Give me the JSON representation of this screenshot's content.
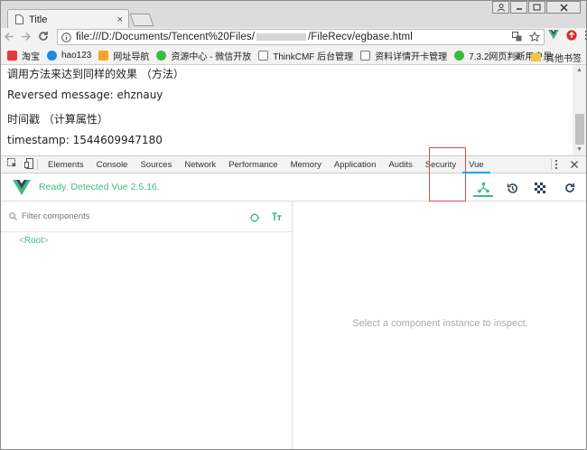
{
  "browser": {
    "tab_title": "Title",
    "tab_close": "×",
    "url_prefix": "file:///D:/Documents/Tencent%20Files/",
    "url_suffix": "/FileRecv/egbase.html",
    "bookmarks": [
      {
        "label": "淘宝",
        "color": "#e4393c",
        "icon": "taobao-icon"
      },
      {
        "label": "hao123",
        "color": "#1e88e5",
        "icon": "hao123-icon"
      },
      {
        "label": "网址导航",
        "color": "#f5a623",
        "icon": "nav-icon"
      },
      {
        "label": "资源中心 - 微信开放",
        "color": "#3dbb3d",
        "icon": "wechat-icon"
      },
      {
        "label": "ThinkCMF 后台管理",
        "color": "#ffffff",
        "icon": "page-icon"
      },
      {
        "label": "资料详情开卡管理",
        "color": "#ffffff",
        "icon": "page-icon"
      },
      {
        "label": "7.3.2网页判断用户是",
        "color": "#3dbb3d",
        "icon": "globe-icon"
      }
    ],
    "bookmarks_more": "»",
    "other_bookmarks": "其他书签"
  },
  "page": {
    "lines": [
      "调用方法来达到同样的效果 （方法）",
      "Reversed message: ehznauy",
      "时间戳 （计算属性）",
      "timestamp: 1544609947180"
    ]
  },
  "devtools": {
    "tabs": [
      "Elements",
      "Console",
      "Sources",
      "Network",
      "Performance",
      "Memory",
      "Application",
      "Audits",
      "Security",
      "Vue"
    ],
    "active_tab": "Vue",
    "accent": "#03a9f4"
  },
  "vue": {
    "status": "Ready. Detected Vue 2.5.16.",
    "filter_placeholder": "Filter components",
    "root_label": "Root",
    "empty_message": "Select a component instance to inspect.",
    "accent": "#42b983"
  }
}
